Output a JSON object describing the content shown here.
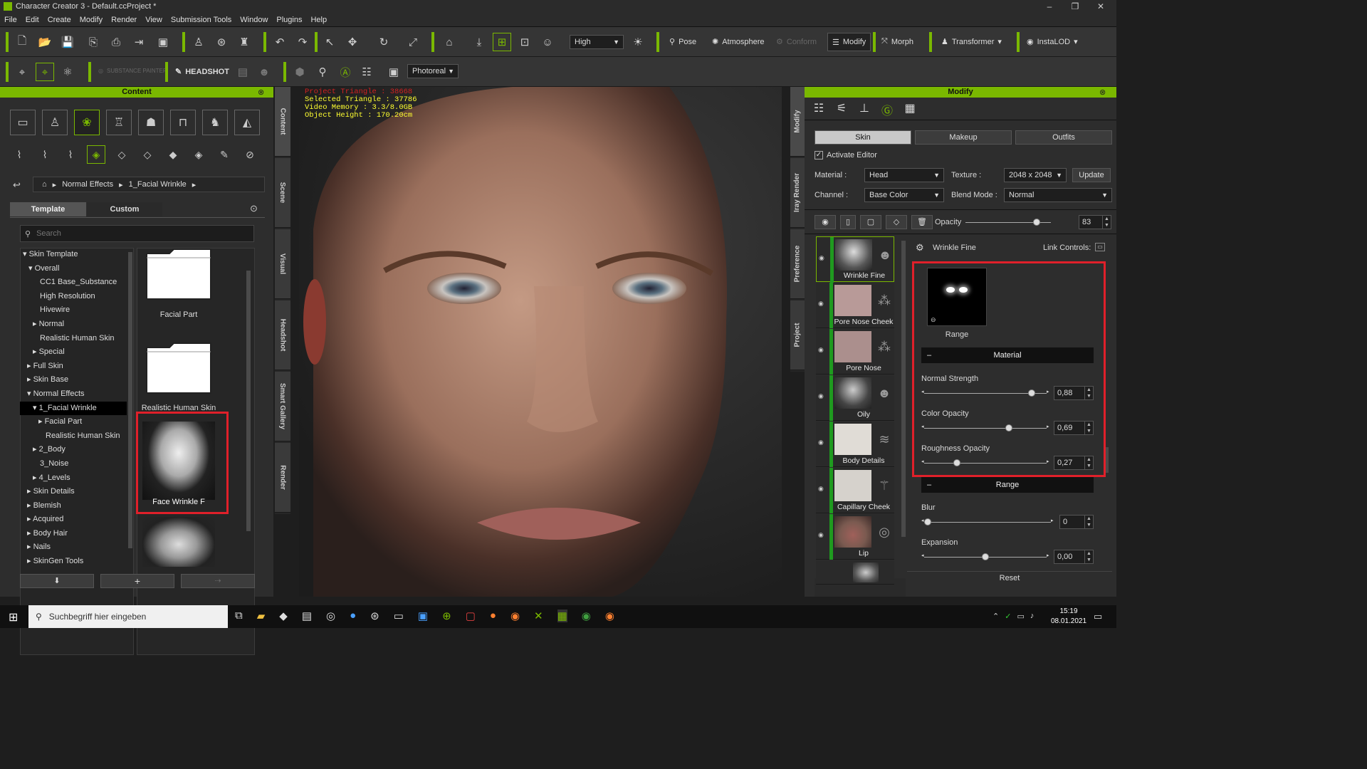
{
  "window": {
    "title": "Character Creator 3 - Default.ccProject *",
    "min": "–",
    "max": "❐",
    "close": "✕"
  },
  "menu": [
    "File",
    "Edit",
    "Create",
    "Modify",
    "Render",
    "View",
    "Submission Tools",
    "Window",
    "Plugins",
    "Help"
  ],
  "toolbar": {
    "quality": "High",
    "pose": "Pose",
    "atmosphere": "Atmosphere",
    "conform": "Conform",
    "modify": "Modify",
    "morph": "Morph",
    "transformer": "Transformer",
    "instalod": "InstaLOD",
    "headshot": "HEADSHOT",
    "substance": "SUBSTANCE PAINTER",
    "render_mode": "Photoreal"
  },
  "content_panel": {
    "title": "Content",
    "breadcrumb": [
      "Normal Effects",
      "1_Facial Wrinkle"
    ],
    "tabs": [
      "Template",
      "Custom"
    ],
    "search_placeholder": "Search",
    "tree": [
      "Skin Template",
      "Overall",
      "CC1 Base_Substance",
      "High Resolution",
      "Hivewire",
      "Normal",
      "Realistic Human Skin",
      "Special",
      "Full Skin",
      "Skin Base",
      "Normal Effects",
      "1_Facial Wrinkle",
      "Facial Part",
      "Realistic Human Skin",
      "2_Body",
      "3_Noise",
      "4_Levels",
      "Skin Details",
      "Blemish",
      "Acquired",
      "Body Hair",
      "Nails",
      "SkinGen Tools"
    ],
    "items": [
      "Facial Part",
      "Realistic Human Skin",
      "Face Wrinkle F"
    ]
  },
  "side_tabs": [
    "Content",
    "Scene",
    "Visual",
    "Headshot",
    "Smart Gallery",
    "Render"
  ],
  "right_side_tabs": [
    "Modify",
    "Iray Render",
    "Preference",
    "Project"
  ],
  "stats": {
    "line1": "Project Triangle : 38668",
    "line2": "Selected Triangle : 37786",
    "line3": "Video Memory : 3.3/8.0GB",
    "line4": "Object Height : 170.20cm"
  },
  "modify_panel": {
    "title": "Modify",
    "tabs": [
      "Skin",
      "Makeup",
      "Outfits"
    ],
    "activate_editor": "Activate Editor",
    "material_label": "Material :",
    "material": "Head",
    "texture_label": "Texture :",
    "texture": "2048 x 2048",
    "update": "Update",
    "channel_label": "Channel :",
    "channel": "Base Color",
    "blend_label": "Blend Mode :",
    "blend": "Normal",
    "opacity_label": "Opacity",
    "opacity": "83",
    "layer_title": "Wrinkle Fine",
    "link_controls": "Link Controls:",
    "layers": [
      "Wrinkle Fine",
      "Pore Nose Cheek",
      "Pore Nose",
      "Oily",
      "Body Details",
      "Capillary Cheek",
      "Lip"
    ],
    "range_label": "Range",
    "material_section": "Material",
    "range_section": "Range",
    "normal_strength_label": "Normal Strength",
    "normal_strength": "0,88",
    "normal_strength_frac": 0.88,
    "color_opacity_label": "Color Opacity",
    "color_opacity": "0,69",
    "color_opacity_frac": 0.69,
    "roughness_label": "Roughness Opacity",
    "roughness": "0,27",
    "roughness_frac": 0.27,
    "blur_label": "Blur",
    "blur": "0",
    "blur_frac": 0,
    "expansion_label": "Expansion",
    "expansion": "0,00",
    "expansion_frac": 0.5,
    "reset": "Reset"
  },
  "taskbar": {
    "search": "Suchbegriff hier eingeben",
    "time": "15:19",
    "date": "08.01.2021"
  },
  "colors": {
    "accent": "#7ab800",
    "highlight": "#e0202a"
  }
}
